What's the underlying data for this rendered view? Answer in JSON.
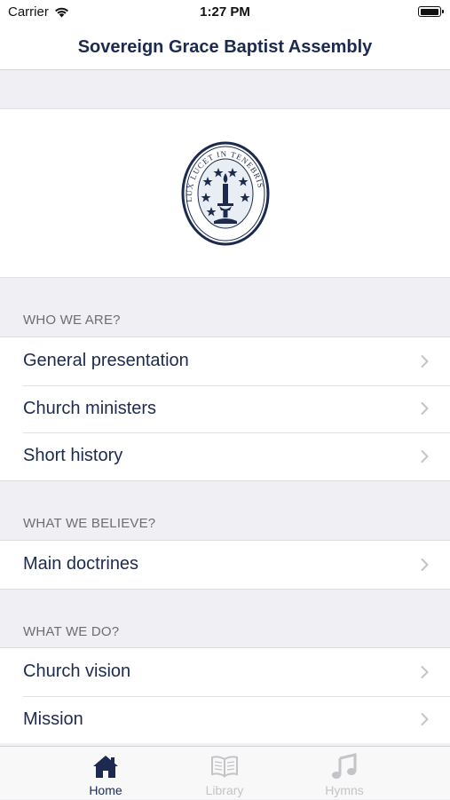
{
  "status_bar": {
    "carrier": "Carrier",
    "time": "1:27 PM"
  },
  "nav": {
    "title": "Sovereign Grace Baptist Assembly"
  },
  "logo": {
    "text": "LUX LUCET IN TENEBRIS"
  },
  "sections": [
    {
      "header": "WHO WE ARE?",
      "items": [
        {
          "label": "General presentation"
        },
        {
          "label": "Church ministers"
        },
        {
          "label": "Short history"
        }
      ]
    },
    {
      "header": "WHAT WE BELIEVE?",
      "items": [
        {
          "label": "Main doctrines"
        }
      ]
    },
    {
      "header": "WHAT WE DO?",
      "items": [
        {
          "label": "Church vision"
        },
        {
          "label": "Mission"
        }
      ]
    }
  ],
  "tabs": [
    {
      "label": "Home",
      "icon": "home-icon",
      "active": true
    },
    {
      "label": "Library",
      "icon": "book-icon",
      "active": false
    },
    {
      "label": "Hymns",
      "icon": "music-note-icon",
      "active": false
    }
  ],
  "colors": {
    "accent": "#1c2a4f",
    "inactive": "#c4c4c8",
    "background": "#efeff4"
  }
}
